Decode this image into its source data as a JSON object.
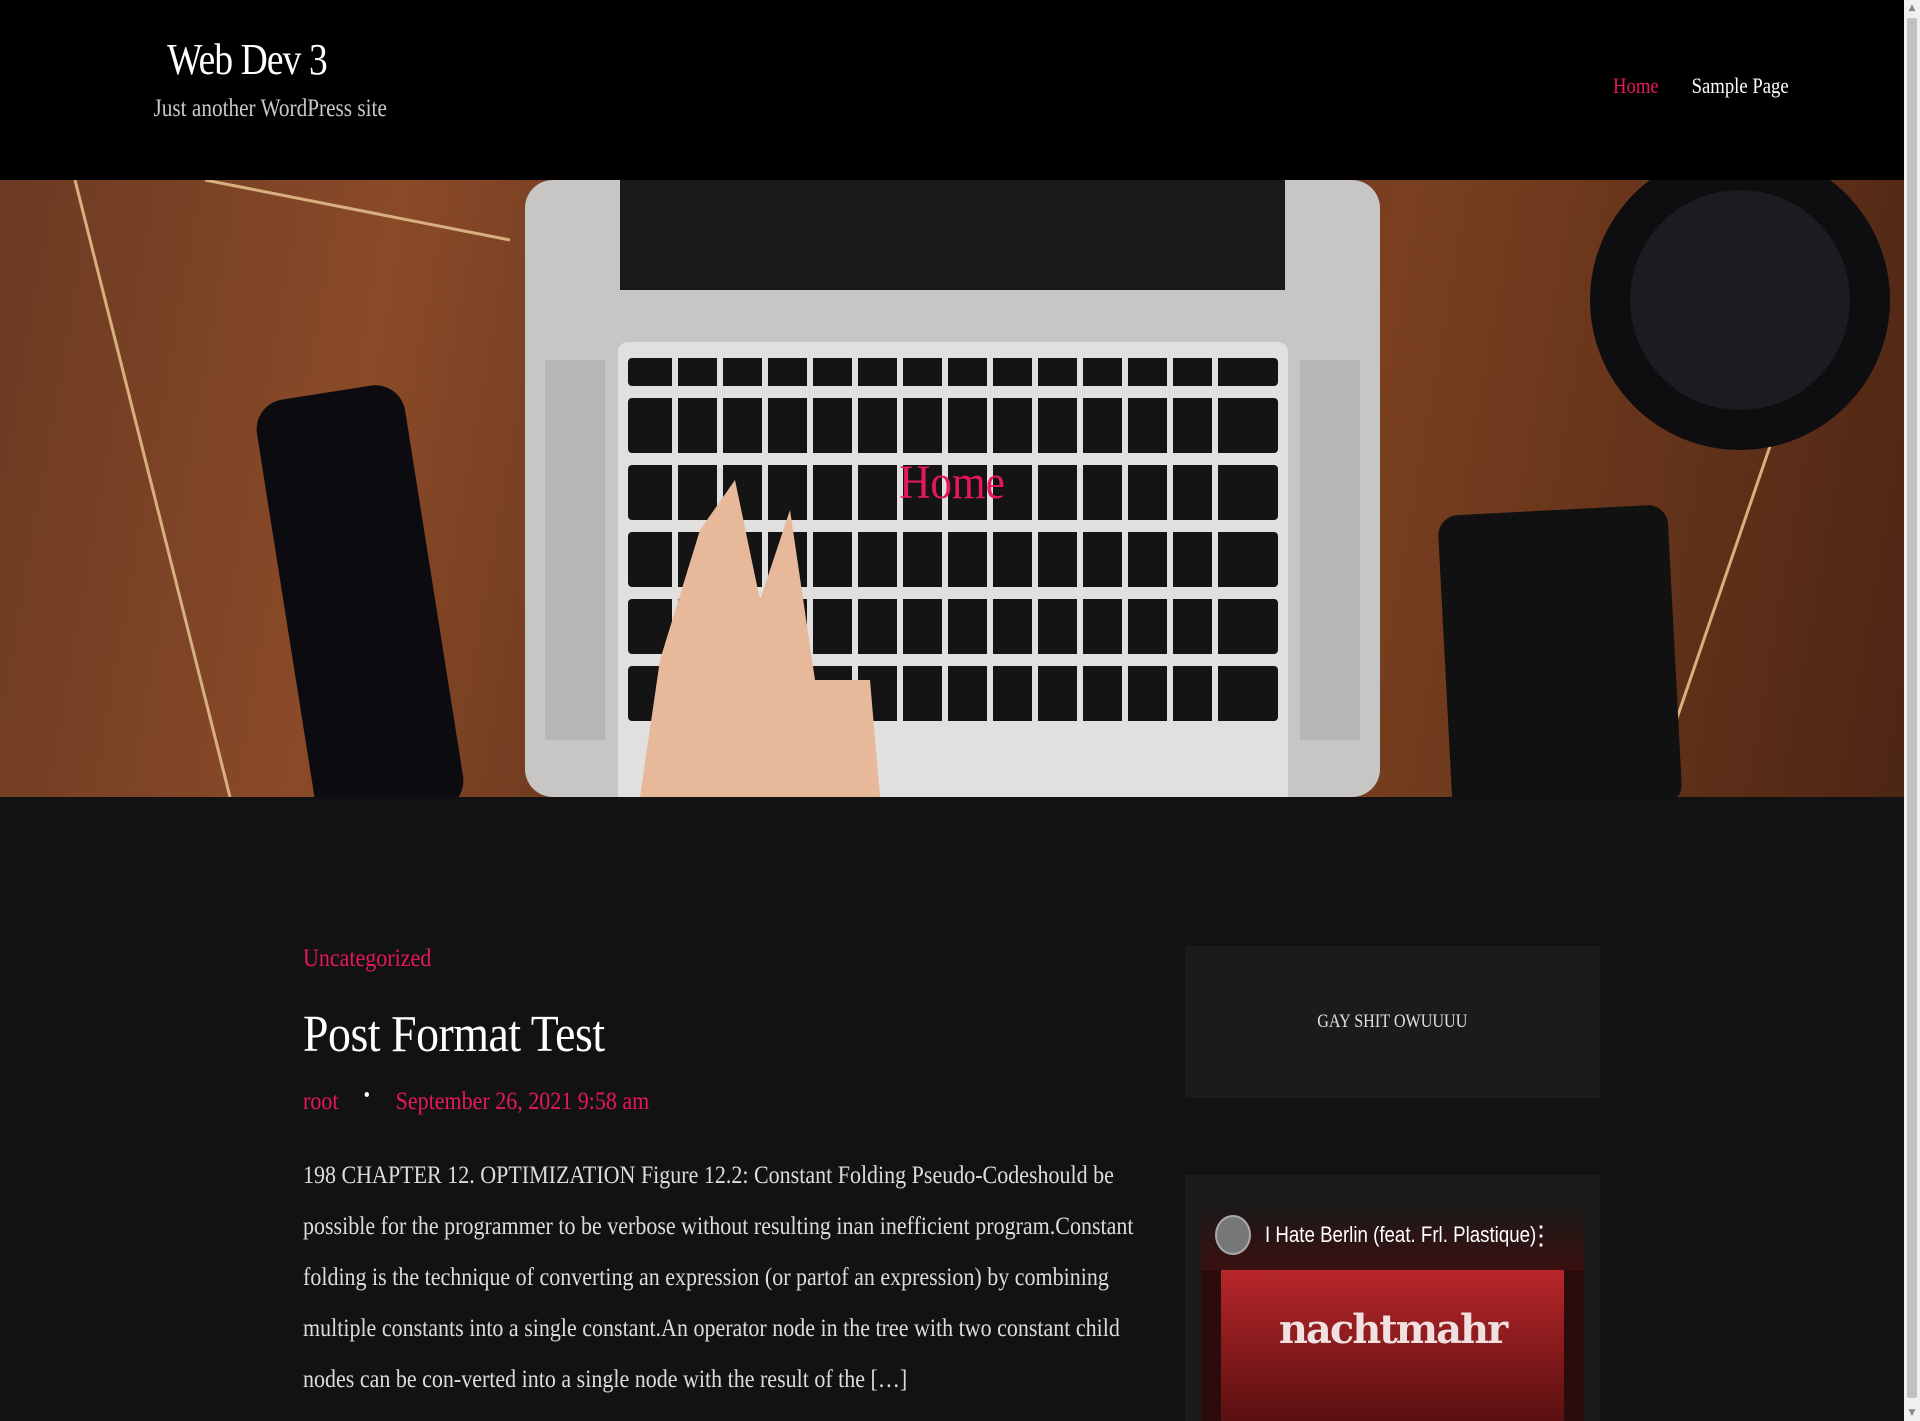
{
  "header": {
    "site_title": "Web Dev 3",
    "tagline": "Just another WordPress site",
    "nav": [
      {
        "label": "Home",
        "current": true
      },
      {
        "label": "Sample Page",
        "current": false
      }
    ]
  },
  "hero": {
    "title": "Home"
  },
  "post": {
    "category": "Uncategorized",
    "title": "Post Format Test",
    "author": "root",
    "date": "September 26, 2021 9:58 am",
    "excerpt": "198 CHAPTER 12. OPTIMIZATION Figure 12.2: Constant Folding Pseudo-Codeshould be possible for the programmer to be verbose without resulting inan inefficient program.Constant folding is the technique of converting an expression (or partof an expression) by combining multiple constants into a single constant.An operator node in the tree with two constant child nodes can be con-verted into a single node with the result of the […]"
  },
  "sidebar": {
    "text_widget": "GAY SHIT OWUUUU",
    "video": {
      "title": "I Hate Berlin (feat. Frl. Plastique)",
      "art_text": "nachtmahr"
    }
  },
  "colors": {
    "accent": "#e5195a",
    "header_bg": "#000000",
    "body_bg": "#121212",
    "widget_bg": "#1b1b1b"
  },
  "icons": {
    "video_menu": "more-vert-icon",
    "scroll_up": "arrow-up-icon",
    "scroll_down": "arrow-down-icon"
  }
}
